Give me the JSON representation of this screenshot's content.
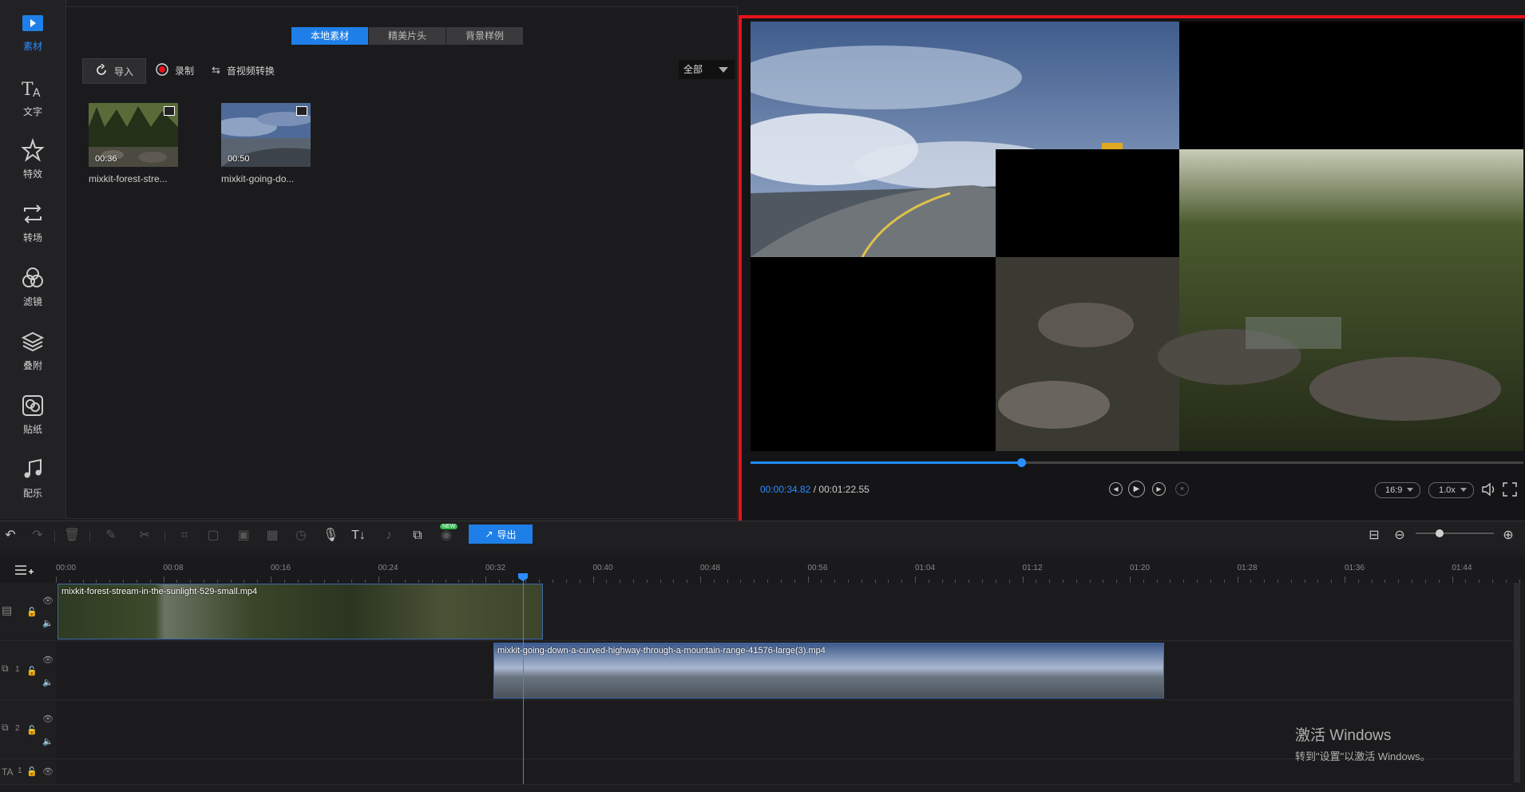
{
  "nav": {
    "items": [
      {
        "label": "素材",
        "icon": "media-icon",
        "active": true
      },
      {
        "label": "文字",
        "icon": "text-icon"
      },
      {
        "label": "特效",
        "icon": "effects-star-icon"
      },
      {
        "label": "转场",
        "icon": "transition-icon"
      },
      {
        "label": "滤镜",
        "icon": "filter-icon"
      },
      {
        "label": "叠附",
        "icon": "overlay-layers-icon"
      },
      {
        "label": "贴纸",
        "icon": "sticker-icon"
      },
      {
        "label": "配乐",
        "icon": "music-icon"
      }
    ]
  },
  "media": {
    "tabs": [
      "本地素材",
      "精美片头",
      "背景样例"
    ],
    "import_label": "导入",
    "record_label": "录制",
    "convert_label": "音视频转换",
    "filter_value": "全部",
    "files": [
      {
        "name": "mixkit-forest-stre...",
        "duration": "00:36"
      },
      {
        "name": "mixkit-going-do...",
        "duration": "00:50"
      }
    ]
  },
  "preview": {
    "current_time": "00:00:34.82",
    "total_time": "/ 00:01:22.55",
    "progress": 0.35,
    "aspect": "16:9",
    "speed": "1.0x"
  },
  "toolbar": {
    "export_label": "导出",
    "new_badge": "NEW"
  },
  "timeline": {
    "ruler": [
      "00:00",
      "00:08",
      "00:16",
      "00:24",
      "00:32",
      "00:40",
      "00:48",
      "00:56",
      "01:04",
      "01:12",
      "01:20",
      "01:28",
      "01:36",
      "01:44"
    ],
    "track1_clip": "mixkit-forest-stream-in-the-sunlight-529-small.mp4",
    "track2_clip": "mixkit-going-down-a-curved-highway-through-a-mountain-range-41576-large(3).mp4",
    "track_labels": [
      "1",
      "2",
      "1"
    ]
  },
  "watermark": {
    "line1": "激活 Windows",
    "line2": "转到\"设置\"以激活 Windows。"
  },
  "colors": {
    "accent": "#1f7fe8",
    "highlight_frame": "#e8121b"
  }
}
